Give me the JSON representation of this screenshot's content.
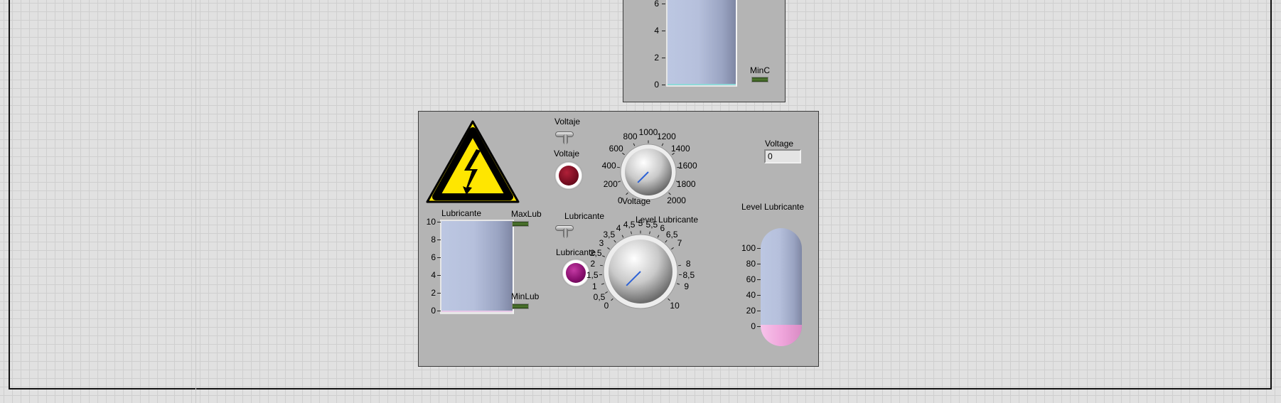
{
  "top_panel": {
    "tank": {
      "ticks": [
        "6",
        "4",
        "2",
        "0"
      ]
    },
    "min_led_label": "MinC"
  },
  "main_panel": {
    "warning_icon": "high-voltage-warning-sign",
    "voltaje_switch_label": "Voltaje",
    "voltaje_led_label": "Voltaje",
    "voltage_knob": {
      "label": "Voltage",
      "ticks": [
        "0",
        "200",
        "400",
        "600",
        "800",
        "1000",
        "1200",
        "1400",
        "1600",
        "1800",
        "2000"
      ],
      "min": 0,
      "max": 2000,
      "value": 0
    },
    "voltage_numeric": {
      "label": "Voltage",
      "value": "0"
    },
    "lubricante_tank": {
      "label": "Lubricante",
      "ticks": [
        "10",
        "8",
        "6",
        "4",
        "2",
        "0"
      ],
      "max_led_label": "MaxLub",
      "min_led_label": "MinLub"
    },
    "lubricante_switch_label": "Lubricante",
    "lubricante_led_label": "Lubricante",
    "level_knob": {
      "label": "Level Lubricante",
      "ticks": [
        "0",
        "0,5",
        "1",
        "1,5",
        "2",
        "2,5",
        "3",
        "3,5",
        "4",
        "4,5",
        "5",
        "5,5",
        "6",
        "6,5",
        "7",
        "8",
        "8,5",
        "9",
        "10"
      ],
      "min": 0,
      "max": 10,
      "value": 0
    },
    "level_thermo": {
      "label": "Level Lubricante",
      "ticks": [
        "100",
        "80",
        "60",
        "40",
        "20",
        "0"
      ],
      "value": 0
    }
  },
  "colors": {
    "panel_bg": "#b4b4b4",
    "tank_fill": "#b6c0dc",
    "led_voltaje": "#7a0e22",
    "led_lubricante": "#8a1070",
    "warning_yellow": "#ffe600",
    "thermo_fill": "#f0a6dc",
    "knob_needle": "#2d62d6"
  }
}
